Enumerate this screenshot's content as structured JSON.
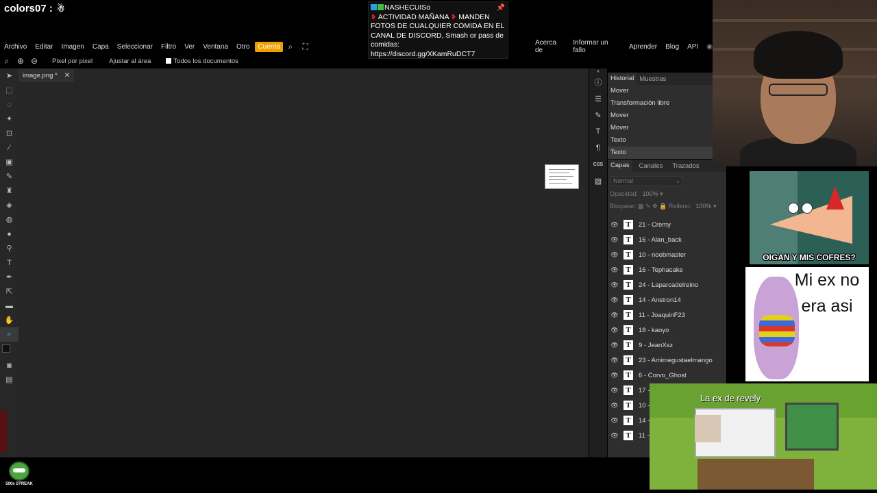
{
  "overlay": {
    "chat_username": "colors07 :",
    "banner": {
      "user": "NASHECUISo",
      "line1": "ACTIVIDAD MAÑANA",
      "line1b": "MANDEN",
      "line2": "FOTOS DE CUALQUIER COMIDA EN EL",
      "line3": "CANAL DE DISCORD, Smash or pass de",
      "line4": "comidas:",
      "line5": "https://discord.gg/XKamRuDCT7"
    },
    "streak_label": "500s STREAK"
  },
  "menubar": {
    "items": [
      "Archivo",
      "Editar",
      "Imagen",
      "Capa",
      "Seleccionar",
      "Filtro",
      "Ver",
      "Ventana",
      "Otro"
    ],
    "account": "Cuenta",
    "right_items": [
      "Acerca de",
      "Informar un fallo",
      "Aprender",
      "Blog",
      "API"
    ]
  },
  "optbar": {
    "pixel": "Pixel por pixel",
    "fit": "Ajustar al área",
    "all_docs": "Todos los documentos"
  },
  "document": {
    "tab": "image.png *"
  },
  "history": {
    "tabs": [
      "Historial",
      "Muestras"
    ],
    "items": [
      "Mover",
      "Transformación libre",
      "Mover",
      "Mover",
      "Texto",
      "Texto"
    ]
  },
  "layers": {
    "tabs": [
      "Capas",
      "Canales",
      "Trazados"
    ],
    "blend_mode": "Normal",
    "opacity_label": "Opacidad:",
    "opacity_value": "100%",
    "lock_label": "Bloquear:",
    "fill_label": "Relleno:",
    "fill_value": "100%",
    "items": [
      "21 - Cremy",
      "16 - Alan_back",
      "10 - noobmaster",
      "16 - Tephacake",
      "24 - Laparcadelreino",
      "14 - Anstron14",
      "11 - JoaquinF23",
      "18 - kaoyo",
      "9 - JeanXsz",
      "23 - Amimegustaelmango",
      "6 - Corvo_Ghost",
      "17 -",
      "10 -",
      "14 -",
      "11 -"
    ]
  },
  "memes": {
    "phineas_caption": "OIGAN Y MIS COFRES?",
    "uniqua_line1": "Mi ex no",
    "uniqua_line2": "era asi",
    "minecraft_caption": "La ex de revely"
  }
}
